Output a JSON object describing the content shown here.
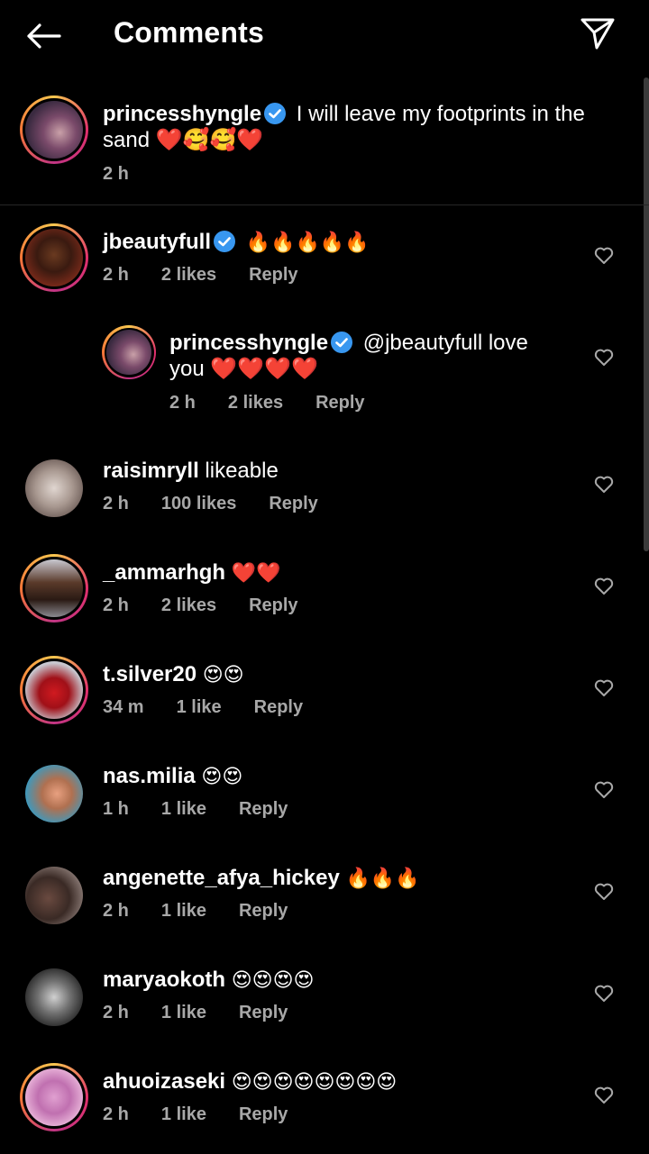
{
  "header": {
    "title": "Comments",
    "back_icon": "arrow-left-icon",
    "send_icon": "paper-plane-icon"
  },
  "caption": {
    "username": "princesshyngle",
    "verified": true,
    "text": "I will leave my footprints in the sand ❤️🥰🥰❤️",
    "time": "2 h"
  },
  "comments": [
    {
      "username": "jbeautyfull",
      "verified": true,
      "text": "🔥🔥🔥🔥🔥",
      "time": "2 h",
      "likes": "2 likes",
      "reply": "Reply"
    },
    {
      "username": "princesshyngle",
      "verified": true,
      "text": "@jbeautyfull love you ❤️❤️❤️❤️",
      "time": "2 h",
      "likes": "2 likes",
      "reply": "Reply"
    },
    {
      "username": "raisimryll",
      "verified": false,
      "text": "likeable",
      "time": "2 h",
      "likes": "100 likes",
      "reply": "Reply"
    },
    {
      "username": "_ammarhgh",
      "verified": false,
      "text": "❤️❤️",
      "time": "2 h",
      "likes": "2 likes",
      "reply": "Reply"
    },
    {
      "username": "t.silver20",
      "verified": false,
      "text": "😍😍",
      "time": "34 m",
      "likes": "1 like",
      "reply": "Reply"
    },
    {
      "username": "nas.milia",
      "verified": false,
      "text": "😍😍",
      "time": "1 h",
      "likes": "1 like",
      "reply": "Reply"
    },
    {
      "username": "angenette_afya_hickey",
      "verified": false,
      "text": "🔥🔥🔥",
      "time": "2 h",
      "likes": "1 like",
      "reply": "Reply"
    },
    {
      "username": "maryaokoth",
      "verified": false,
      "text": "😍😍😍😍",
      "time": "2 h",
      "likes": "1 like",
      "reply": "Reply"
    },
    {
      "username": "ahuoizaseki",
      "verified": false,
      "text": "😍😍😍😍😍😍😍😍",
      "time": "2 h",
      "likes": "1 like",
      "reply": "Reply"
    }
  ],
  "colors": {
    "background": "#000000",
    "meta_text": "#a8a8a8",
    "verified": "#3897f0"
  }
}
